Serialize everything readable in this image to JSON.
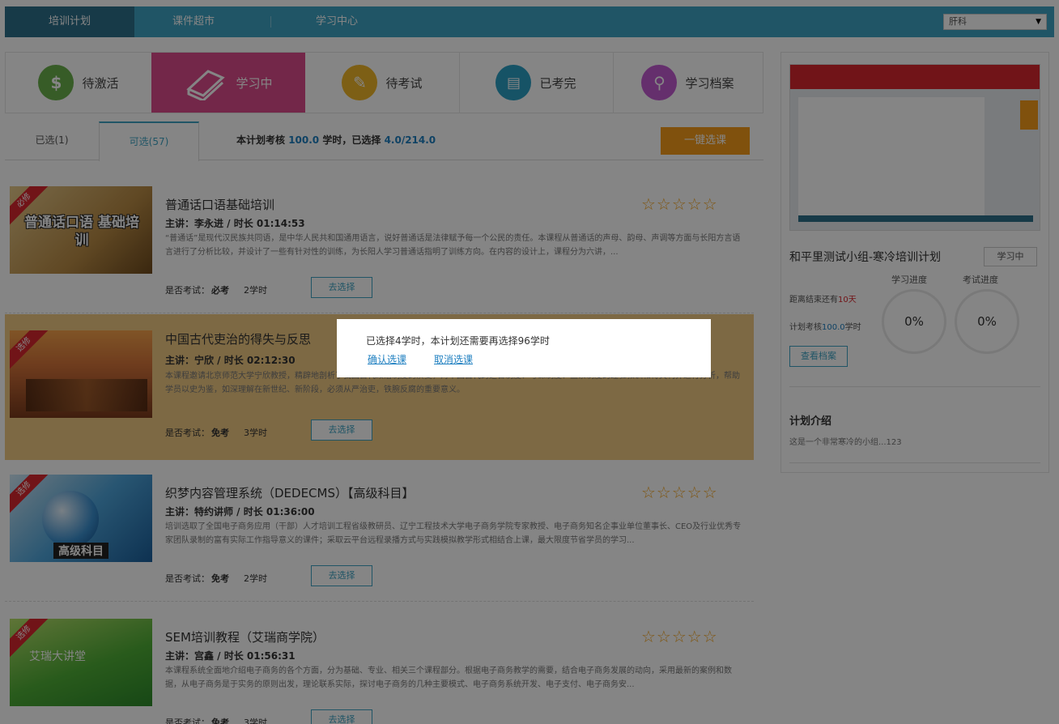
{
  "topnav": {
    "tabs": [
      "培训计划",
      "课件超市",
      "学习中心"
    ],
    "active_tab": 0,
    "select_value": "肝科"
  },
  "statusbar": {
    "items": [
      {
        "label": "待激活",
        "icon": "dollar-icon",
        "icon_char": "$",
        "color": "#6ab04c"
      },
      {
        "label": "学习中",
        "icon": "book-icon",
        "icon_char": "",
        "color": "#dc4c8c"
      },
      {
        "label": "待考试",
        "icon": "pencil-icon",
        "icon_char": "✎",
        "color": "#f0b62a"
      },
      {
        "label": "已考完",
        "icon": "certificate-icon",
        "icon_char": "▤",
        "color": "#2b9fc4"
      },
      {
        "label": "学习档案",
        "icon": "search-icon",
        "icon_char": "⚲",
        "color": "#c15bd1"
      }
    ],
    "active_index": 1
  },
  "tabs": {
    "selected": "已选(1)",
    "available": "可选(57)",
    "plan_text_1": "本计划考核",
    "plan_hours": "100.0",
    "plan_text_2": "学时，已选择",
    "plan_selected": "4.0/214.0",
    "one_click": "一键选课"
  },
  "courses": [
    {
      "badge": "必修",
      "thumb_text": "普通话口语 基础培训",
      "title": "普通话口语基础培训",
      "lecturer": "主讲：李永进 / 时长 01:14:53",
      "desc": "“普通话”是现代汉民族共同语，是中华人民共和国通用语言，说好普通话是法律赋予每一个公民的责任。本课程从普通话的声母、韵母、声调等方面与长阳方言语言进行了分析比较，并设计了一些有针对性的训练，为长阳人学习普通话指明了训练方向。在内容的设计上，课程分为六讲，...",
      "exam_label": "是否考试：",
      "exam_value": "必考",
      "hours": "2学时",
      "button": "去选择"
    },
    {
      "badge": "选修",
      "thumb_text": "",
      "title": "中国古代吏治的得失与反思",
      "lecturer": "主讲：宁欣 / 时长 02:12:30",
      "desc": "本课程邀请北京师范大学宁欣教授，精辟地剖析了我国古代政治制度的演变，对中国古代的选官制度、考课制度、监察制度的经验教训和得失利弊进行分析，帮助学员以史为鉴，如深理解在新世纪、新阶段，必须从严治吏，铁腕反腐的重要意义。",
      "exam_label": "是否考试：",
      "exam_value": "免考",
      "hours": "3学时",
      "button": "去选择"
    },
    {
      "badge": "选修",
      "thumb_text": "高级科目",
      "title": "织梦内容管理系统（DEDECMS）【高级科目】",
      "lecturer": "主讲：特约讲师 / 时长 01:36:00",
      "desc": "培训选取了全国电子商务应用（干部）人才培训工程省级教研员、辽宁工程技术大学电子商务学院专家教授、电子商务知名企事业单位董事长、CEO及行业优秀专家团队录制的富有实际工作指导意义的课件；采取云平台远程录播方式与实践模拟教学形式相结合上课，最大限度节省学员的学习...",
      "exam_label": "是否考试：",
      "exam_value": "免考",
      "hours": "2学时",
      "button": "去选择"
    },
    {
      "badge": "选修",
      "thumb_text": "艾瑞大讲堂",
      "title": "SEM培训教程（艾瑞商学院）",
      "lecturer": "主讲：宫鑫 / 时长 01:56:31",
      "desc": "本课程系统全面地介绍电子商务的各个方面，分为基础、专业、相关三个课程部分。根据电子商务教学的需要，结合电子商务发展的动向，采用最新的案例和数据，从电子商务是于实务的原则出发，理论联系实际，探讨电子商务的几种主要模式、电子商务系统开发、电子支付、电子商务安...",
      "exam_label": "是否考试：",
      "exam_value": "免考",
      "hours": "3学时",
      "button": "去选择"
    }
  ],
  "stars_text": "☆☆☆☆☆",
  "right": {
    "plan_title": "和平里测试小组-寒冷培训计划",
    "status_tag": "学习中",
    "study_progress_label": "学习进度",
    "exam_progress_label": "考试进度",
    "days_prefix": "距离结束还有",
    "days_value": "10天",
    "assess_prefix": "计划考核",
    "assess_value": "100.0",
    "assess_suffix": "学时",
    "study_progress": "0%",
    "exam_progress": "0%",
    "view_button": "查看档案",
    "intro_heading": "计划介绍",
    "intro_text": "这是一个非常寒冷的小组...123"
  },
  "dialog": {
    "message": "已选择4学时，本计划还需要再选择96学时",
    "confirm": "确认选课",
    "cancel": "取消选课"
  }
}
